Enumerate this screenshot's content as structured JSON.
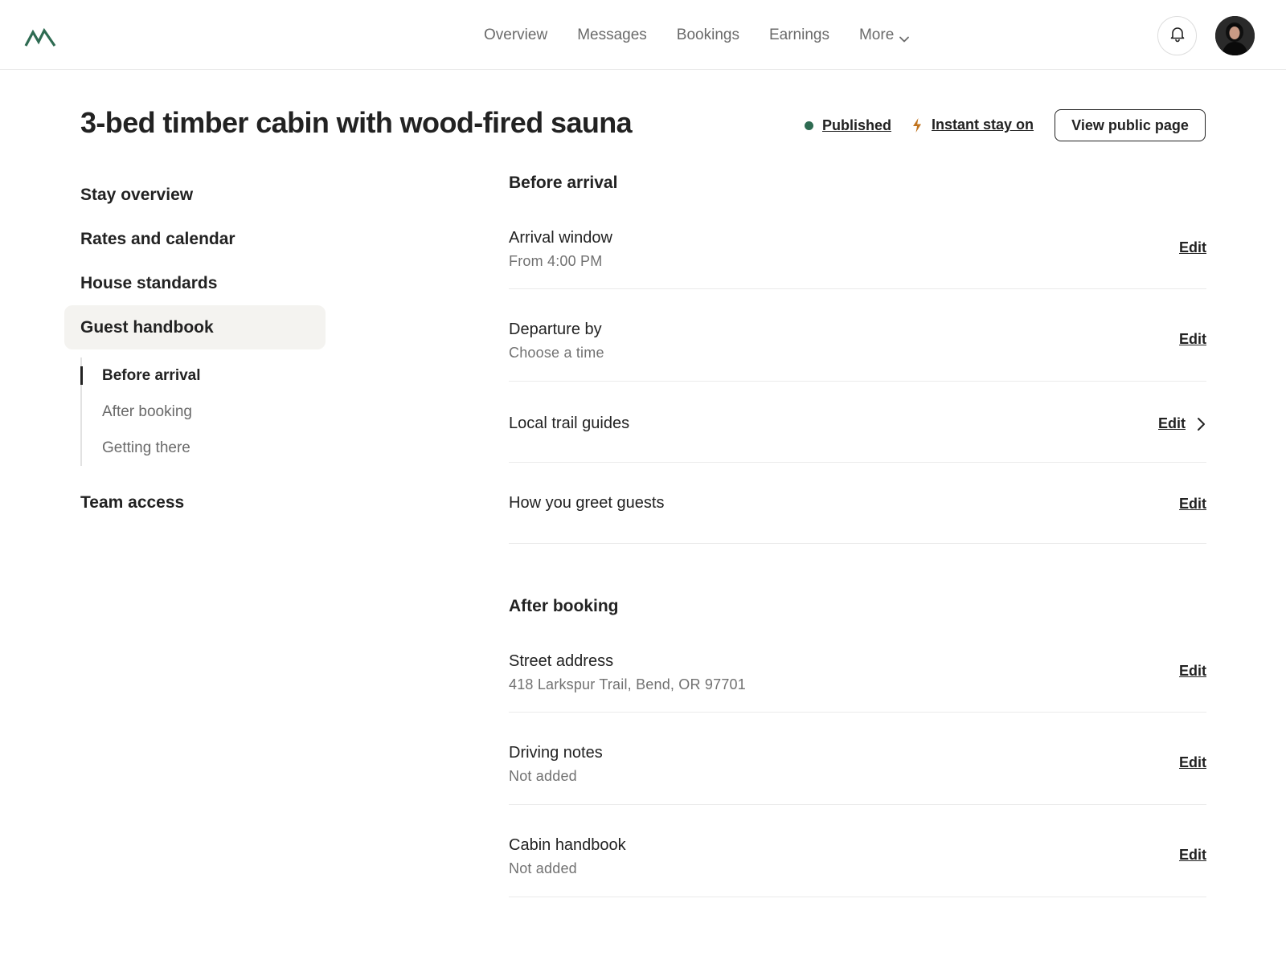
{
  "header": {
    "logo_icon": "mountain-logo-icon",
    "nav": [
      {
        "label": "Overview"
      },
      {
        "label": "Messages"
      },
      {
        "label": "Bookings"
      },
      {
        "label": "Earnings"
      },
      {
        "label": "More"
      }
    ],
    "bell_icon": "bell-icon",
    "avatar_icon": "user-avatar"
  },
  "listing": {
    "title": "3-bed timber cabin with wood-fired sauna",
    "status_label": "Published",
    "status_color": "#2e6b52",
    "instant_label": "Instant stay on",
    "instant_icon_color": "#c1741f",
    "view_button": "View public page"
  },
  "sidebar": {
    "items": [
      {
        "label": "Stay overview"
      },
      {
        "label": "Rates and calendar"
      },
      {
        "label": "House standards"
      },
      {
        "label": "Guest handbook",
        "active": true
      },
      {
        "label": "Team access"
      }
    ],
    "sub_items": [
      {
        "label": "Before arrival",
        "active": true
      },
      {
        "label": "After booking"
      },
      {
        "label": "Getting there"
      }
    ]
  },
  "sections": [
    {
      "heading": "Before arrival",
      "rows": [
        {
          "label": "Arrival window",
          "value": "From 4:00 PM",
          "action": "Edit"
        },
        {
          "label": "Departure by",
          "value": "Choose a time",
          "action": "Edit"
        },
        {
          "label": "Local trail guides",
          "action": "Edit"
        },
        {
          "label": "How you greet guests",
          "action": "Edit"
        }
      ]
    },
    {
      "heading": "After booking",
      "rows": [
        {
          "label": "Street address",
          "value": "418 Larkspur Trail, Bend, OR 97701",
          "action": "Edit"
        },
        {
          "label": "Driving notes",
          "value": "Not added",
          "action": "Edit"
        },
        {
          "label": "Cabin handbook",
          "value": "Not added",
          "action": "Edit"
        }
      ]
    }
  ]
}
